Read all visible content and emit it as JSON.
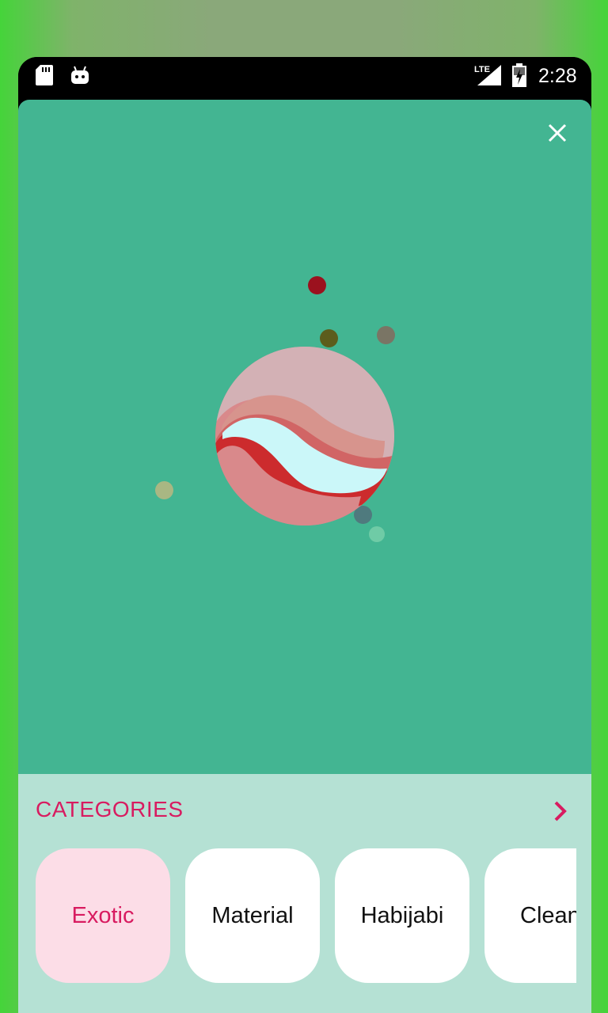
{
  "status_bar": {
    "network": "LTE",
    "time": "2:28",
    "icons": [
      "sd-card-icon",
      "android-icon",
      "signal-icon",
      "battery-charging-icon"
    ]
  },
  "hero": {
    "background_color": "#43b592",
    "close_icon": "close-icon"
  },
  "categories": {
    "title": "CATEGORIES",
    "more_icon": "chevron-right-icon",
    "accent_color": "#d81b60",
    "items": [
      {
        "label": "Exotic",
        "selected": true
      },
      {
        "label": "Material",
        "selected": false
      },
      {
        "label": "Habijabi",
        "selected": false
      },
      {
        "label": "Clean",
        "selected": false
      }
    ]
  }
}
